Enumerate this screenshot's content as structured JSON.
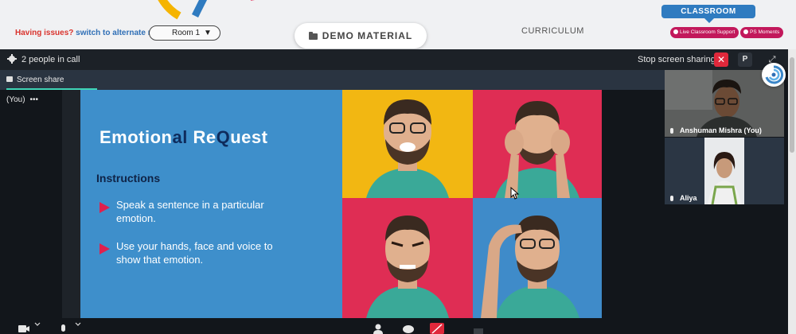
{
  "topbar": {
    "issue_prefix": "Having issues?",
    "issue_link": "switch to alternate room",
    "room_select": "Room 1",
    "demo_material": "DEMO MATERIAL",
    "curriculum": "CURRICULUM",
    "classroom": "CLASSROOM",
    "live_support": "Live Classroom Support",
    "ps_moments": "PS Moments"
  },
  "callbar": {
    "people": "2 people in call",
    "stop_sharing": "Stop screen sharing",
    "p_button": "P"
  },
  "tab": {
    "label": "Screen share (You)",
    "more": "•••"
  },
  "slide": {
    "title_parts": [
      "Emotion",
      "al ",
      "Re",
      "Q",
      "uest"
    ],
    "instructions": "Instructions",
    "bullets": [
      "Speak a sentence in a particular emotion.",
      "Use your hands, face and voice to show that emotion."
    ]
  },
  "participants": [
    {
      "name": "Anshuman Mishra (You)"
    },
    {
      "name": "Aliya"
    }
  ],
  "colors": {
    "slide_bg": "#3e8fcb",
    "yellow": "#f2b712",
    "magenta": "#df2d54",
    "accent_red": "#e0283b",
    "tab_underline": "#3fd4b6",
    "classroom_blue": "#2f7bc0"
  }
}
